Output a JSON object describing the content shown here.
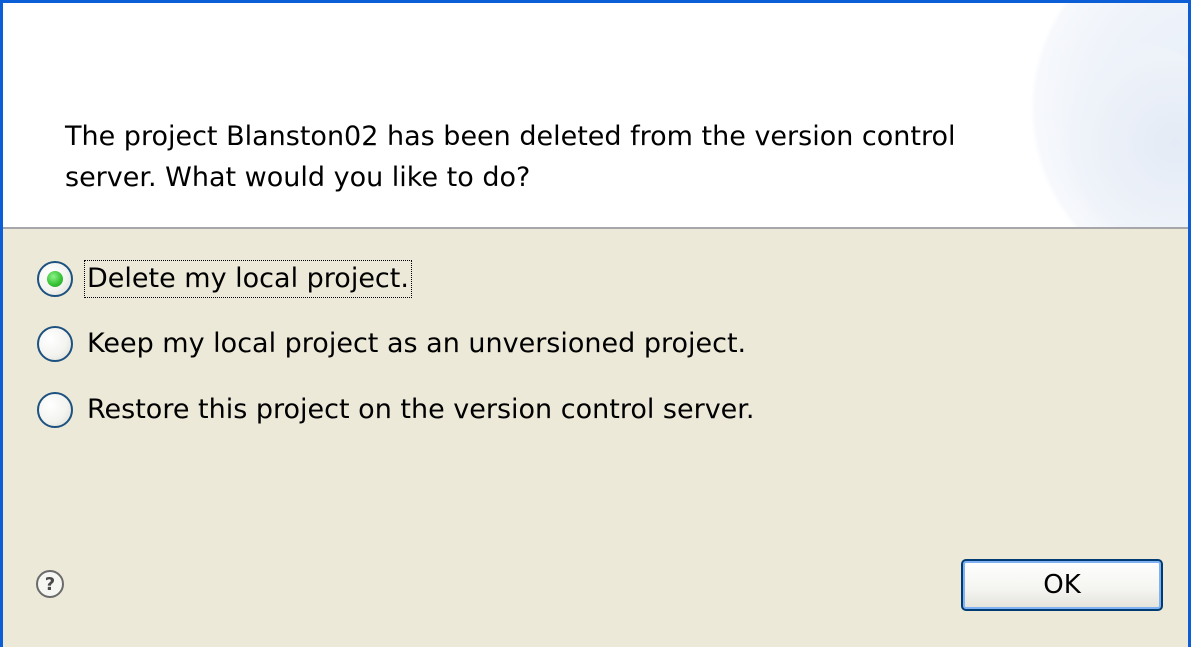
{
  "dialog": {
    "message": "The project Blanston02 has been deleted from the version control\nserver.  What would you like to do?",
    "options": [
      {
        "label": "Delete my local project.",
        "selected": true
      },
      {
        "label": "Keep my local project as an unversioned project.",
        "selected": false
      },
      {
        "label": "Restore this project on the version control server.",
        "selected": false
      }
    ],
    "help_icon_glyph": "?",
    "ok_label": "OK"
  },
  "colors": {
    "frame_border": "#0b5ed6",
    "body_background": "#ece9d8",
    "header_background": "#ffffff",
    "radio_selected": "#39c437"
  },
  "icons": {
    "help": "help-icon",
    "radio": "radio-icon"
  }
}
